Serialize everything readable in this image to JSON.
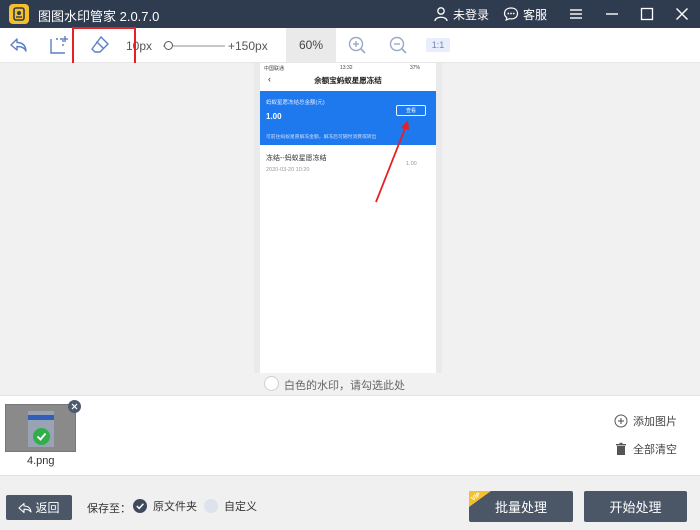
{
  "app": {
    "title": "图图水印管家  2.0.7.0"
  },
  "header": {
    "login_label": "未登录",
    "service_label": "客服"
  },
  "toolbar": {
    "brush_min": "10px",
    "brush_max": "+150px",
    "brush_level_percent": 5,
    "zoom": "60%",
    "ratio_label": "1:1"
  },
  "preview": {
    "status_left": "中国联通",
    "status_time": "13:32",
    "status_right": "37%",
    "nav_title": "余额宝蚂蚁星愿冻结",
    "card_label": "蚂蚁星愿冻结总金额(元)",
    "card_amount": "1.00",
    "card_button": "查看",
    "card_note": "可前往蚂蚁星愿解冻金额，解冻后可随时消费或转出",
    "record_title": "冻结--蚂蚁星愿冻结",
    "record_date": "2020-03-20 10:20",
    "record_amount": "1.00"
  },
  "watermark_option": {
    "label": "白色的水印，请勾选此处",
    "checked": false
  },
  "thumbnails": [
    {
      "name": "4.png"
    }
  ],
  "side_actions": {
    "add_label": "添加图片",
    "clear_label": "全部清空"
  },
  "bottom": {
    "back_label": "返回",
    "save_to_label": "保存至：",
    "option_original": "原文件夹",
    "option_custom": "自定义",
    "batch_label": "批量处理",
    "vip_label": "VIP",
    "start_label": "开始处理"
  },
  "colors": {
    "titlebar": "#2f3c50",
    "button": "#4b5667",
    "highlight": "#e52222",
    "vip": "#f5c02c",
    "card": "#1e78ee"
  }
}
